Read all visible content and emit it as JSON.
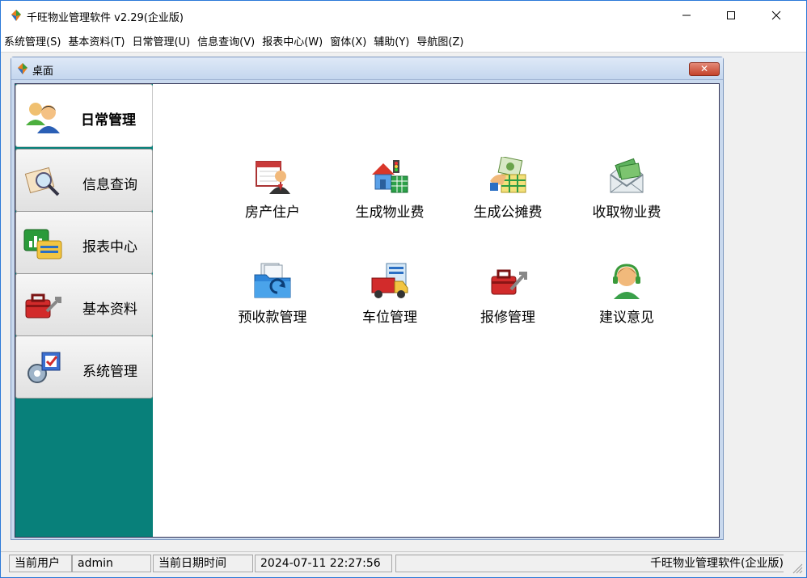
{
  "window": {
    "title": "千旺物业管理软件 v2.29(企业版)",
    "controls": {
      "minimize": "—",
      "maximize": "☐",
      "close": "✕"
    }
  },
  "menu": [
    "系统管理(S)",
    "基本资料(T)",
    "日常管理(U)",
    "信息查询(V)",
    "报表中心(W)",
    "窗体(X)",
    "辅助(Y)",
    "导航图(Z)"
  ],
  "child_window": {
    "title": "桌面",
    "close": "✕"
  },
  "nav": [
    {
      "label": "日常管理",
      "icon": "users-icon",
      "active": true
    },
    {
      "label": "信息查询",
      "icon": "magnifier-document-icon",
      "active": false
    },
    {
      "label": "报表中心",
      "icon": "report-chart-icon",
      "active": false
    },
    {
      "label": "基本资料",
      "icon": "toolbox-icon",
      "active": false
    },
    {
      "label": "系统管理",
      "icon": "gear-checkbox-icon",
      "active": false
    }
  ],
  "tiles": [
    {
      "label": "房产住户",
      "icon": "resident-calendar-icon"
    },
    {
      "label": "生成物业费",
      "icon": "house-building-icon"
    },
    {
      "label": "生成公摊费",
      "icon": "money-spreadsheet-icon"
    },
    {
      "label": "收取物业费",
      "icon": "money-envelope-icon"
    },
    {
      "label": "预收款管理",
      "icon": "folder-refresh-icon"
    },
    {
      "label": "车位管理",
      "icon": "truck-icon"
    },
    {
      "label": "报修管理",
      "icon": "repair-toolbox-icon"
    },
    {
      "label": "建议意见",
      "icon": "support-headset-icon"
    }
  ],
  "status": {
    "user_label": "当前用户",
    "user_value": "admin",
    "datetime_label": "当前日期时间",
    "datetime_value": "2024-07-11 22:27:56",
    "app_name": "千旺物业管理软件(企业版)"
  },
  "colors": {
    "nav_background": "#08807a",
    "child_title": "#c4d6ee",
    "close_button": "#c4432b"
  }
}
